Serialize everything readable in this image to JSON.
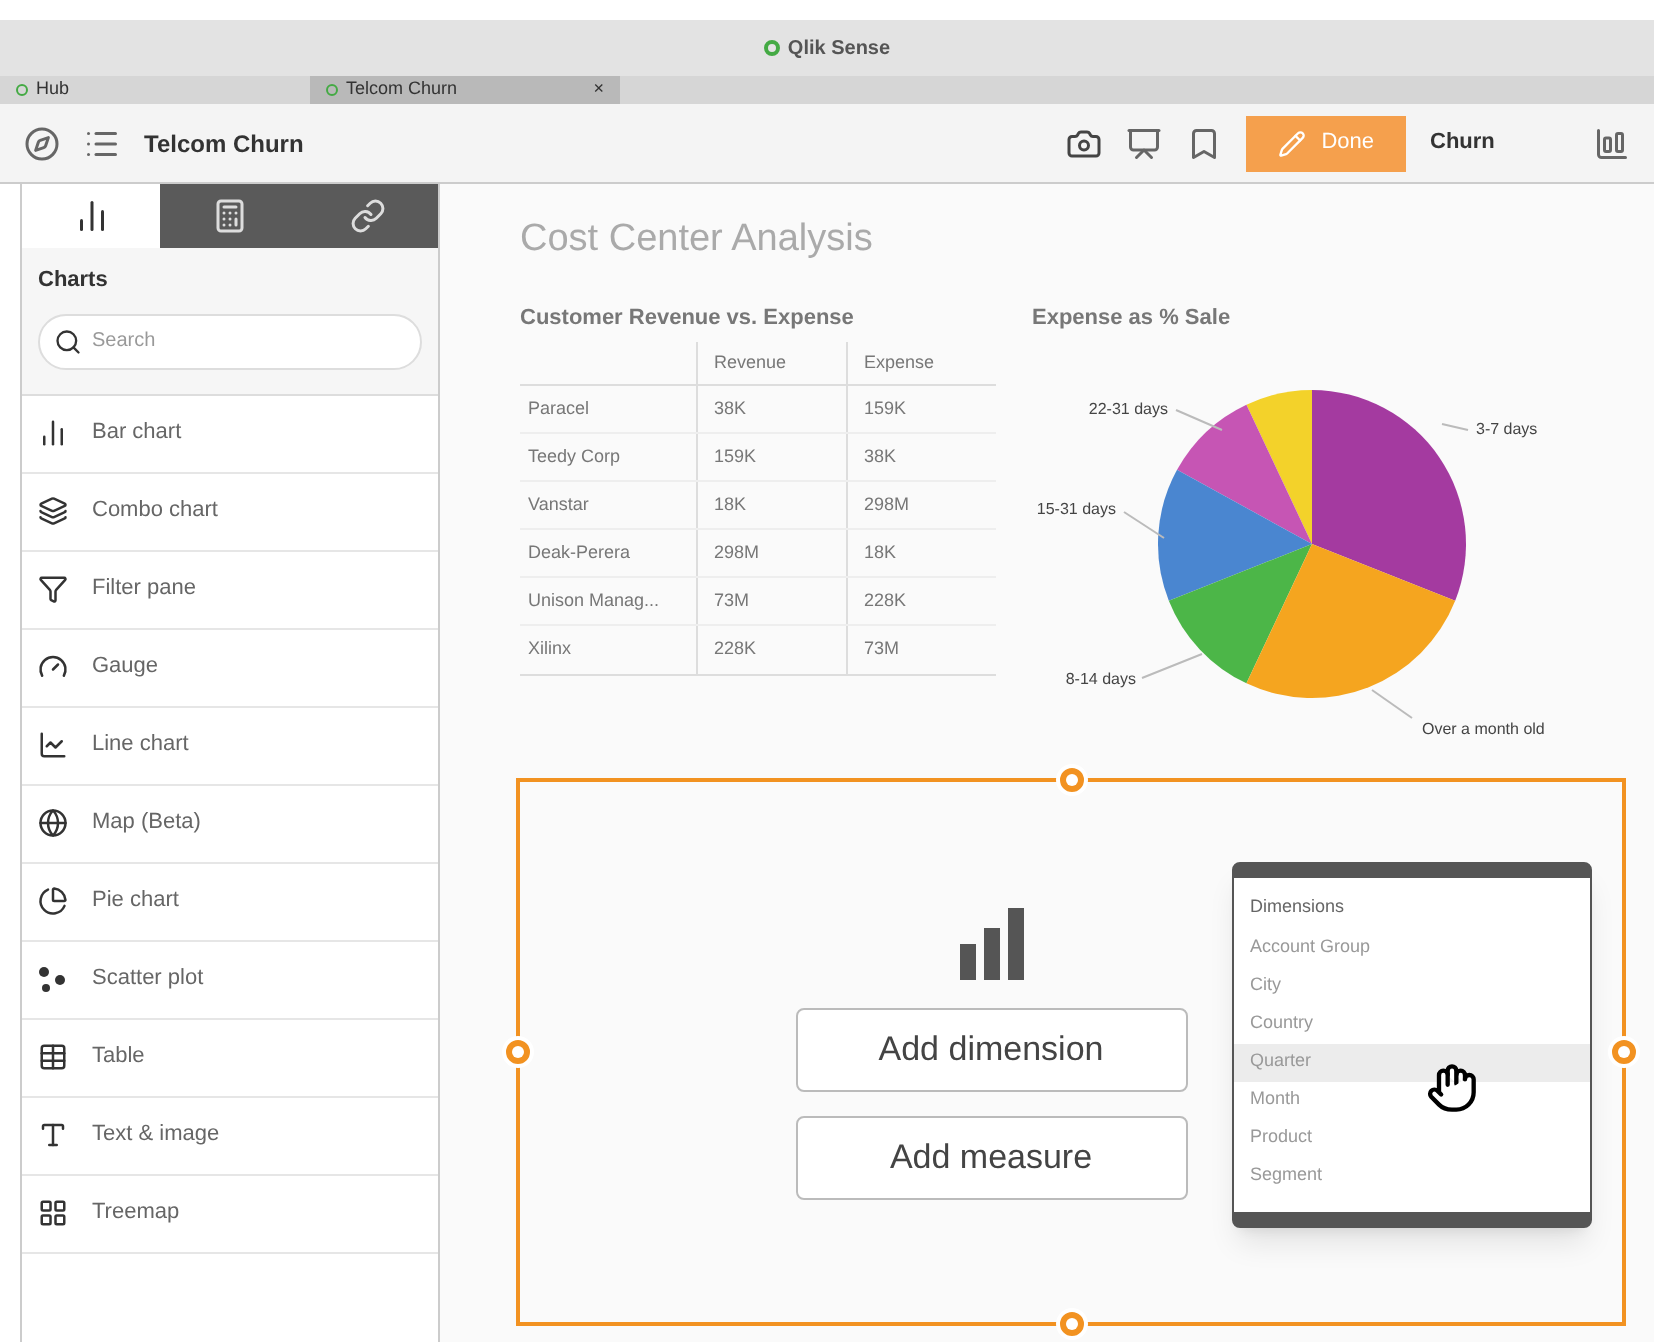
{
  "window": {
    "title": "Qlik Sense"
  },
  "browser_tabs": [
    {
      "label": "Hub",
      "selected": false
    },
    {
      "label": "Telcom Churn",
      "selected": true,
      "close": "×"
    }
  ],
  "toolbar": {
    "app_title": "Telcom Churn",
    "done_button": "Done",
    "sheet_name": "Churn"
  },
  "panel": {
    "tabs": [
      {
        "selected": true
      },
      {
        "selected": false
      },
      {
        "selected": false
      }
    ],
    "heading": "Charts",
    "search": {
      "placeholder": "Search"
    },
    "items": [
      "Bar chart",
      "Combo chart",
      "Filter pane",
      "Gauge",
      "Line chart",
      "Map (Beta)",
      "Pie chart",
      "Scatter plot",
      "Table",
      "Text & image",
      "Treemap"
    ]
  },
  "sheet": {
    "title": "Cost Center Analysis",
    "table": {
      "title": "Customer Revenue vs. Expense",
      "columns": [
        "",
        "Revenue",
        "Expense"
      ],
      "rows": [
        [
          "Paracel",
          "38K",
          "159K"
        ],
        [
          "Teedy Corp",
          "159K",
          "38K"
        ],
        [
          "Vanstar",
          "18K",
          "298M"
        ],
        [
          "Deak-Perera",
          "298M",
          "18K"
        ],
        [
          "Unison Manag...",
          "73M",
          "228K"
        ],
        [
          "Xilinx",
          "228K",
          "73M"
        ]
      ]
    },
    "pie": {
      "title": "Expense as % Sale",
      "slices": [
        {
          "color": "#f3d22a"
        },
        {
          "label": "22-31 days",
          "color": "#c655b4"
        },
        {
          "label": "3-7 days",
          "color": "#a43aa0"
        },
        {
          "label": "15-31 days",
          "color": "#4a86d0"
        },
        {
          "label": "8-14 days",
          "color": "#4cb648"
        },
        {
          "label": "Over a month old",
          "color": "#f5a51f"
        }
      ]
    },
    "new_chart": {
      "add_dimension": "Add dimension",
      "add_measure": "Add measure",
      "menu": {
        "heading": "Dimensions",
        "items": [
          {
            "label": "Account Group",
            "hovered": false
          },
          {
            "label": "City",
            "hovered": false
          },
          {
            "label": "Country",
            "hovered": false
          },
          {
            "label": "Quarter",
            "hovered": true
          },
          {
            "label": "Month",
            "hovered": false
          },
          {
            "label": "Product",
            "hovered": false
          },
          {
            "label": "Segment",
            "hovered": false
          }
        ]
      }
    }
  }
}
